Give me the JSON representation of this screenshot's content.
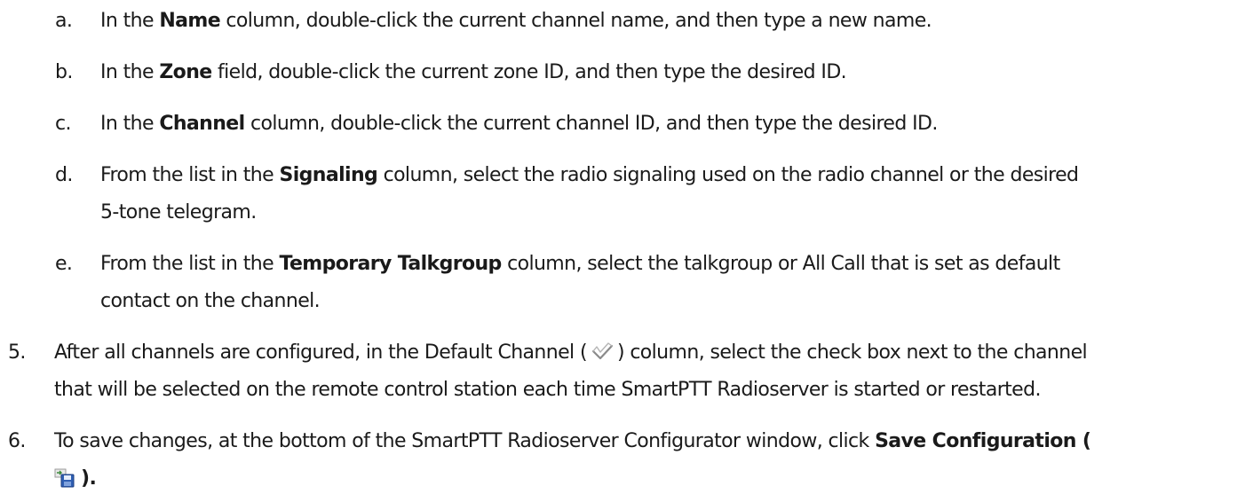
{
  "steps": [
    {
      "marker": "a.",
      "pre": "In the ",
      "bold": "Name",
      "post": " column, double-click the current channel name, and then type a new name."
    },
    {
      "marker": "b.",
      "pre": "In the ",
      "bold": "Zone",
      "post": " field, double-click the current zone ID, and then type the desired ID."
    },
    {
      "marker": "c.",
      "pre": "In the ",
      "bold": "Channel",
      "post": " column, double-click the current channel ID, and then type the desired ID."
    },
    {
      "marker": "d.",
      "pre": "From the list in the ",
      "bold": "Signaling",
      "post": " column, select the radio signaling used on the radio channel or the desired",
      "line2": "5-tone telegram."
    },
    {
      "marker": "e.",
      "pre": "From the list in the ",
      "bold": "Temporary Talkgroup",
      "post": " column, select the talkgroup or All Call that is set as default",
      "line2": "contact on the channel."
    }
  ],
  "step5": {
    "marker": "5.",
    "pre": "After all channels are configured, in the Default Channel (",
    "post": ") column, select the check box next to the channel",
    "line2": "that will be selected on the remote control station each time SmartPTT Radioserver is started or restarted.",
    "icon": "checkmark-icon"
  },
  "step6": {
    "marker": "6.",
    "pre": "To save changes, at the bottom of the SmartPTT Radioserver Configurator window, click ",
    "bold": "Save Configuration (",
    "line2_post": ").",
    "icon": "save-configuration-icon"
  }
}
